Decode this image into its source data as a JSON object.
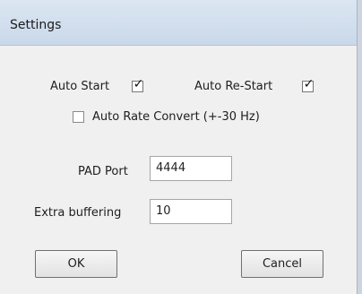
{
  "window": {
    "title": "Settings"
  },
  "settings": {
    "auto_start": {
      "label": "Auto Start",
      "checked": true
    },
    "auto_restart": {
      "label": "Auto Re-Start",
      "checked": true
    },
    "auto_rate_convert": {
      "label": "Auto Rate Convert (+-30 Hz)",
      "checked": false
    },
    "pad_port": {
      "label": "PAD Port",
      "value": "4444"
    },
    "extra_buffering": {
      "label": "Extra buffering",
      "value": "10"
    }
  },
  "buttons": {
    "ok_label": "OK",
    "cancel_label": "Cancel"
  }
}
